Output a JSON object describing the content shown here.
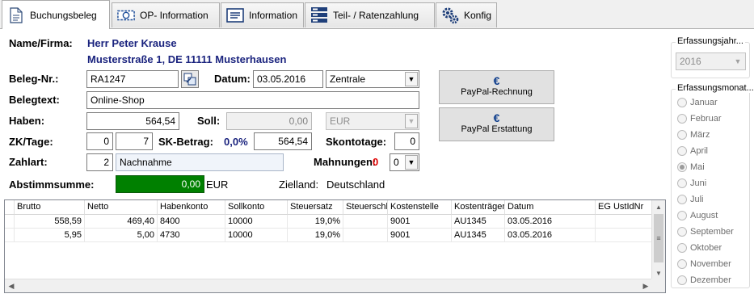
{
  "tabs": [
    {
      "label": "Buchungsbeleg",
      "icon": "document-icon"
    },
    {
      "label": "OP- Information",
      "icon": "money-icon"
    },
    {
      "label": "Information",
      "icon": "info-list-icon"
    },
    {
      "label": "Teil- / Ratenzahlung",
      "icon": "bars-icon"
    },
    {
      "label": "Konfig",
      "icon": "gears-icon"
    }
  ],
  "form": {
    "name_label": "Name/Firma:",
    "name_line1": "Herr Peter Krause",
    "name_line2": "Musterstraße 1, DE 11111 Musterhausen",
    "beleg_label": "Beleg-Nr.:",
    "beleg_value": "RA1247",
    "datum_label": "Datum:",
    "datum_value": "03.05.2016",
    "zentrale_value": "Zentrale",
    "belegtext_label": "Belegtext:",
    "belegtext_value": "Online-Shop",
    "haben_label": "Haben:",
    "haben_value": "564,54",
    "soll_label": "Soll:",
    "soll_value": "0,00",
    "currency_value": "EUR",
    "zk_label": "ZK/Tage:",
    "zk_value": "0",
    "tage_value": "7",
    "sk_label": "SK-Betrag:",
    "sk_percent": "0,0%",
    "sk_value": "564,54",
    "skontotage_label": "Skontotage:",
    "skontotage_value": "0",
    "zahlart_label": "Zahlart:",
    "zahlart_code": "2",
    "zahlart_name": "Nachnahme",
    "mahnungen_label": "Mahnungen:",
    "mahnungen_count": "0",
    "mahnungen_select": "0",
    "abstimm_label": "Abstimmsumme:",
    "abstimm_value": "0,00",
    "abstimm_currency": "EUR",
    "zielland_label": "Zielland:",
    "zielland_value": "Deutschland"
  },
  "buttons": {
    "paypal_rechnung": "PayPal-Rechnung",
    "paypal_erstattung": "PayPal Erstattung",
    "euro_symbol": "€"
  },
  "table": {
    "columns": [
      "Brutto",
      "Netto",
      "Habenkonto",
      "Sollkonto",
      "Steuersatz",
      "Steuerschl",
      "Kostenstelle",
      "Kostenträger",
      "Datum",
      "EG UstIdNr"
    ],
    "rows": [
      [
        "558,59",
        "469,40",
        "8400",
        "10000",
        "19,0%",
        "",
        "9001",
        "AU1345",
        "03.05.2016",
        ""
      ],
      [
        "5,95",
        "5,00",
        "4730",
        "10000",
        "19,0%",
        "",
        "9001",
        "AU1345",
        "03.05.2016",
        ""
      ]
    ]
  },
  "year_group": {
    "title": "Erfassungsjahr...",
    "value": "2016"
  },
  "month_group": {
    "title": "Erfassungsmonat...",
    "months": [
      "Januar",
      "Februar",
      "März",
      "April",
      "Mai",
      "Juni",
      "Juli",
      "August",
      "September",
      "Oktober",
      "November",
      "Dezember"
    ],
    "selected": "Mai"
  },
  "colors": {
    "label_blue": "#1a237e",
    "green_field": "#008000",
    "red": "#e00000"
  }
}
